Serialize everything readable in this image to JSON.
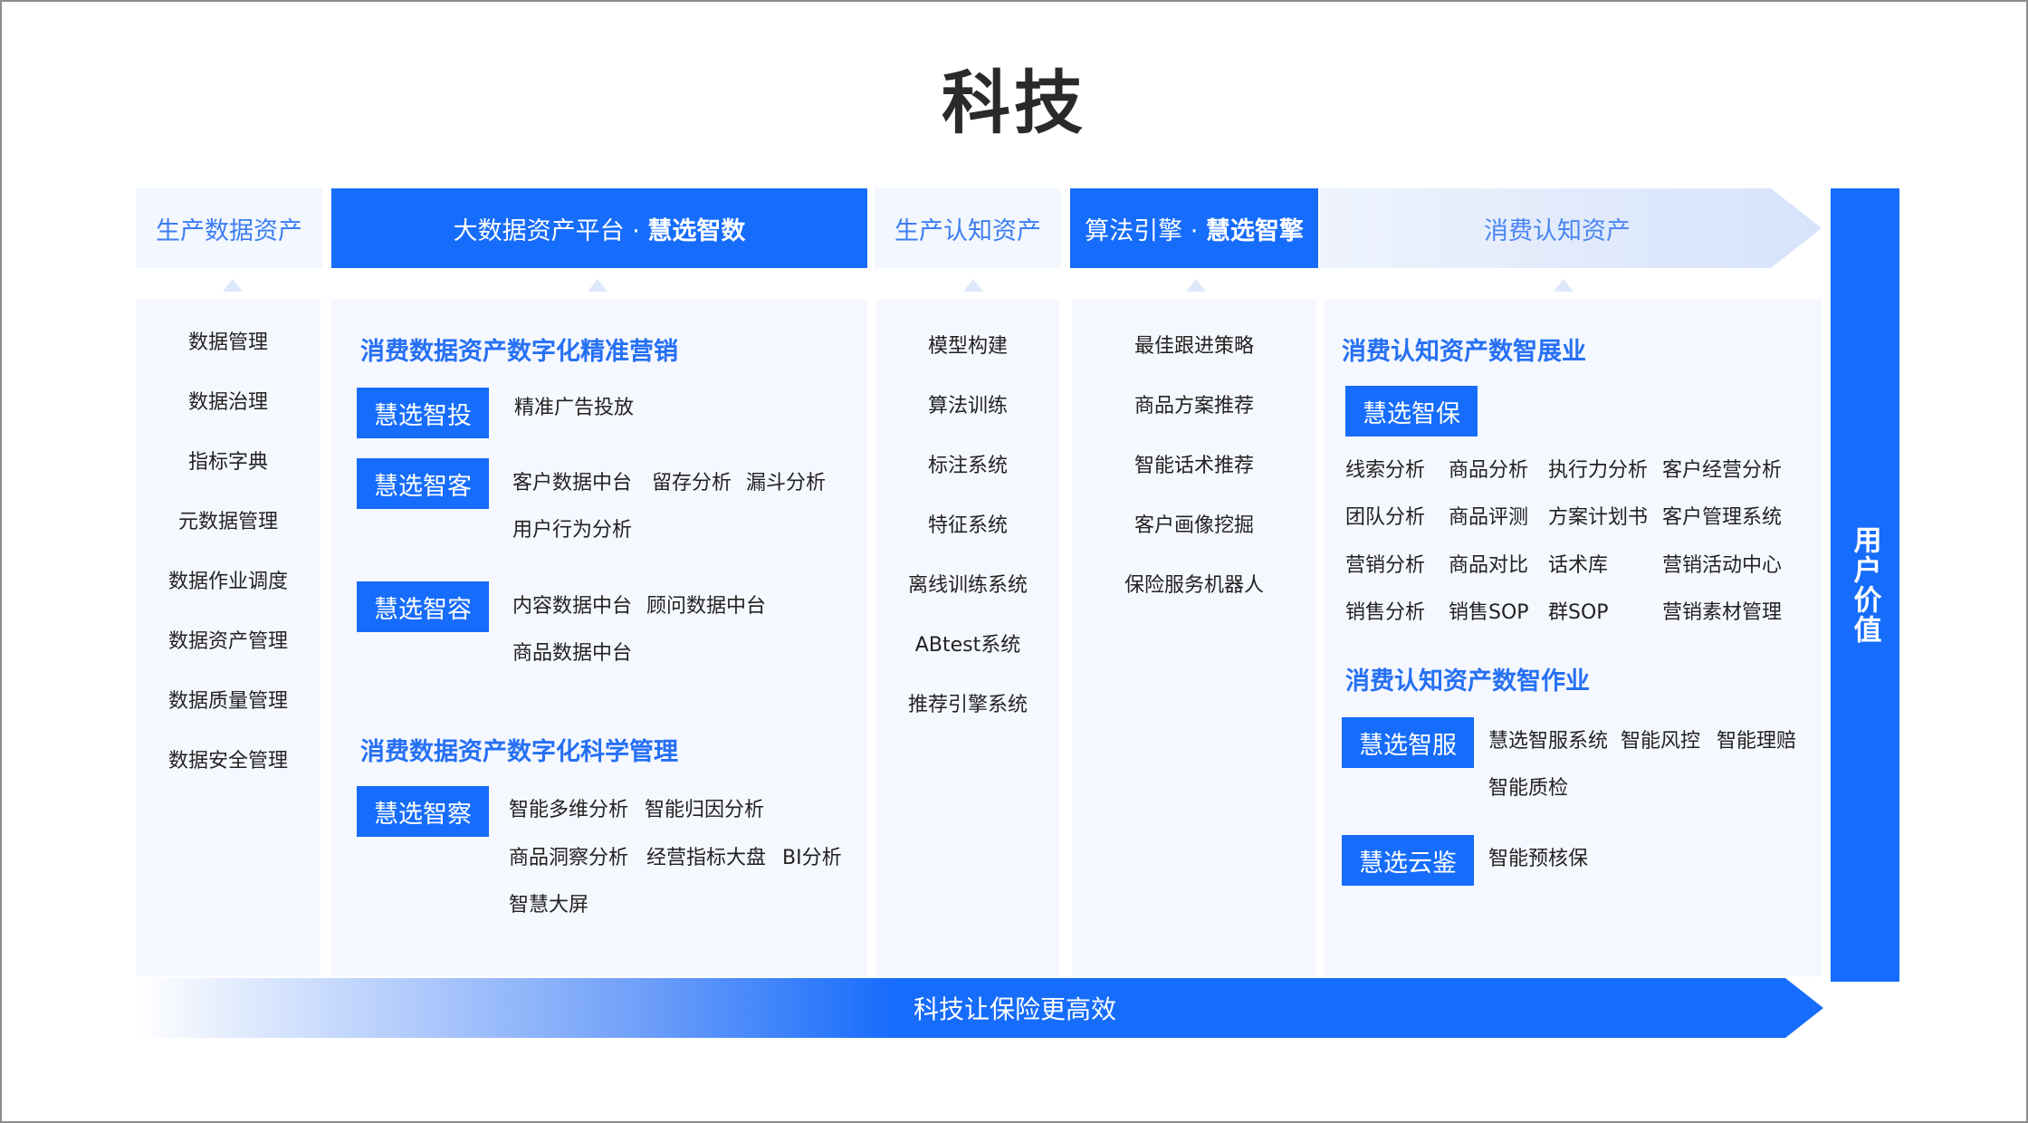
{
  "title": "科技",
  "header": {
    "col1": "生产数据资产",
    "col2_prefix": "大数据资产平台 · ",
    "col2_bold": "慧选智数",
    "col3": "生产认知资产",
    "col4_prefix": "算法引擎 · ",
    "col4_bold": "慧选智擎",
    "col5": "消费认知资产"
  },
  "col1_items": [
    "数据管理",
    "数据治理",
    "指标字典",
    "元数据管理",
    "数据作业调度",
    "数据资产管理",
    "数据质量管理",
    "数据安全管理"
  ],
  "col2": {
    "section1_title": "消费数据资产数字化精准营销",
    "section2_title": "消费数据资产数字化科学管理",
    "products": [
      {
        "name": "慧选智投",
        "tags": [
          "精准广告投放"
        ]
      },
      {
        "name": "慧选智客",
        "tags": [
          "客户数据中台",
          "留存分析",
          "漏斗分析",
          "用户行为分析"
        ]
      },
      {
        "name": "慧选智容",
        "tags": [
          "内容数据中台",
          "顾问数据中台",
          "商品数据中台"
        ]
      },
      {
        "name": "慧选智察",
        "tags": [
          "智能多维分析",
          "智能归因分析",
          "商品洞察分析",
          "经营指标大盘",
          "BI分析",
          "智慧大屏"
        ]
      }
    ]
  },
  "col3_items": [
    "模型构建",
    "算法训练",
    "标注系统",
    "特征系统",
    "离线训练系统",
    "ABtest系统",
    "推荐引擎系统"
  ],
  "col4_items": [
    "最佳跟进策略",
    "商品方案推荐",
    "智能话术推荐",
    "客户画像挖掘",
    "保险服务机器人"
  ],
  "col5": {
    "section1_title": "消费认知资产数智展业",
    "section2_title": "消费认知资产数智作业",
    "product_bao": "慧选智保",
    "grid": [
      [
        "线索分析",
        "商品分析",
        "执行力分析",
        "客户经营分析"
      ],
      [
        "团队分析",
        "商品评测",
        "方案计划书",
        "客户管理系统"
      ],
      [
        "营销分析",
        "商品对比",
        "话术库",
        "营销活动中心"
      ],
      [
        "销售分析",
        "销售SOP",
        "群SOP",
        "营销素材管理"
      ]
    ],
    "product_fu": "慧选智服",
    "fu_tags": [
      "慧选智服系统",
      "智能风控",
      "智能理赔",
      "智能质检"
    ],
    "product_jian": "慧选云鉴",
    "jian_tags": [
      "智能预核保"
    ]
  },
  "side_label": "用户价值",
  "bottom_label": "科技让保险更高效",
  "colors": {
    "primary": "#166cfb",
    "light_bg": "#f5f8fe",
    "title_blue": "#2670f5"
  }
}
